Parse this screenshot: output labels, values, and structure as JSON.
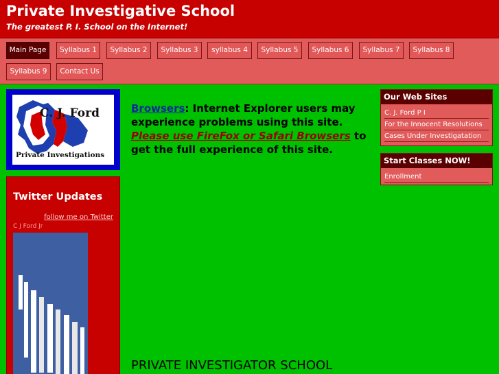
{
  "header": {
    "title": "Private Investigative School",
    "tagline": "The greatest P. I. School on the Internet!"
  },
  "nav": {
    "items": [
      "Main Page",
      "Syllabus 1",
      "Syllabus 2",
      "Syllabus 3",
      "syllabus 4",
      "Syllabus 5",
      "Syllabus 6",
      "Syllabus 7",
      "Syllabus 8",
      "Syllabus 9",
      "Contact Us"
    ],
    "active": "Main Page"
  },
  "logo": {
    "name": "C. J. Ford",
    "subtitle": "Private Investigations"
  },
  "twitter": {
    "title": "Twitter Updates",
    "follow": "follow me on Twitter",
    "user": "C J Ford Jr"
  },
  "main": {
    "browsers_link": "Browsers",
    "note_part1": ": Internet Explorer users may experience problems using this site.",
    "firefox_link": "Please use FireFox or Safari Browsers",
    "note_part2": "to get the full experience of this site.",
    "heading": "PRIVATE INVESTIGATOR SCHOOL"
  },
  "sidebar": {
    "websites_title": "Our Web Sites",
    "websites": [
      "C. J. Ford P I",
      "For the Innocent Resolutions",
      "Cases Under Investigatation"
    ],
    "classes_title": "Start Classes NOW!",
    "classes": [
      "Enrollment"
    ]
  },
  "colors": {
    "header_bg": "#c70000",
    "nav_bg": "#e15b5b",
    "page_bg": "#00c100",
    "active_tab": "#5a0000",
    "logo_frame": "#0000cc"
  }
}
